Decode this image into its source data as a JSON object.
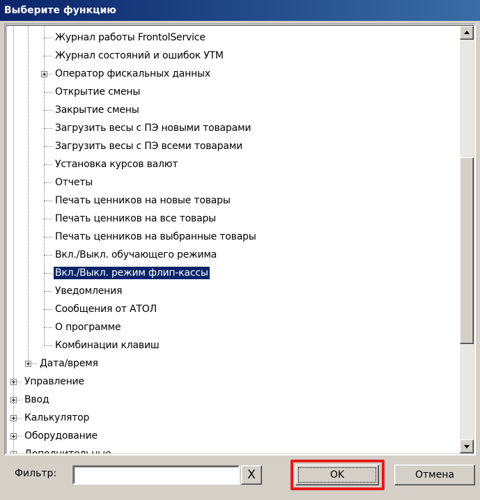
{
  "dialog": {
    "title": "Выберите функцию"
  },
  "tree": {
    "selected_index": 13,
    "rows": [
      {
        "label": "Журнал работы FrontolService",
        "level": 2,
        "expandable": false
      },
      {
        "label": "Журнал состояний и ошибок УТМ",
        "level": 2,
        "expandable": false
      },
      {
        "label": "Оператор фискальных данных",
        "level": 2,
        "expandable": true
      },
      {
        "label": "Открытие смены",
        "level": 2,
        "expandable": false
      },
      {
        "label": "Закрытие смены",
        "level": 2,
        "expandable": false
      },
      {
        "label": "Загрузить весы с ПЭ новыми товарами",
        "level": 2,
        "expandable": false
      },
      {
        "label": "Загрузить весы с ПЭ всеми товарами",
        "level": 2,
        "expandable": false
      },
      {
        "label": "Установка курсов валют",
        "level": 2,
        "expandable": false
      },
      {
        "label": "Отчеты",
        "level": 2,
        "expandable": false
      },
      {
        "label": "Печать ценников на новые товары",
        "level": 2,
        "expandable": false
      },
      {
        "label": "Печать ценников на все товары",
        "level": 2,
        "expandable": false
      },
      {
        "label": "Печать ценников на выбранные товары",
        "level": 2,
        "expandable": false
      },
      {
        "label": "Вкл./Выкл. обучающего режима",
        "level": 2,
        "expandable": false
      },
      {
        "label": "Вкл./Выкл. режим флип-кассы",
        "level": 2,
        "expandable": false
      },
      {
        "label": "Уведомления",
        "level": 2,
        "expandable": false
      },
      {
        "label": "Сообщения от АТОЛ",
        "level": 2,
        "expandable": false
      },
      {
        "label": "О программе",
        "level": 2,
        "expandable": false
      },
      {
        "label": "Комбинации клавиш",
        "level": 2,
        "expandable": false
      },
      {
        "label": "Дата/время",
        "level": 1,
        "expandable": true
      },
      {
        "label": "Управление",
        "level": 0,
        "expandable": true
      },
      {
        "label": "Ввод",
        "level": 0,
        "expandable": true
      },
      {
        "label": "Калькулятор",
        "level": 0,
        "expandable": true
      },
      {
        "label": "Оборудование",
        "level": 0,
        "expandable": true
      },
      {
        "label": "Дополнительные",
        "level": 0,
        "expandable": true
      }
    ]
  },
  "scrollbar": {
    "position_fraction": 0.55
  },
  "filter": {
    "label": "Фильтр:",
    "value": "",
    "clear_label": "X"
  },
  "buttons": {
    "ok_label": "OK",
    "cancel_label": "Отмена"
  },
  "colors": {
    "title_bar": "#0a246a",
    "selection": "#0a246a",
    "highlight_frame": "#e31b1b"
  }
}
